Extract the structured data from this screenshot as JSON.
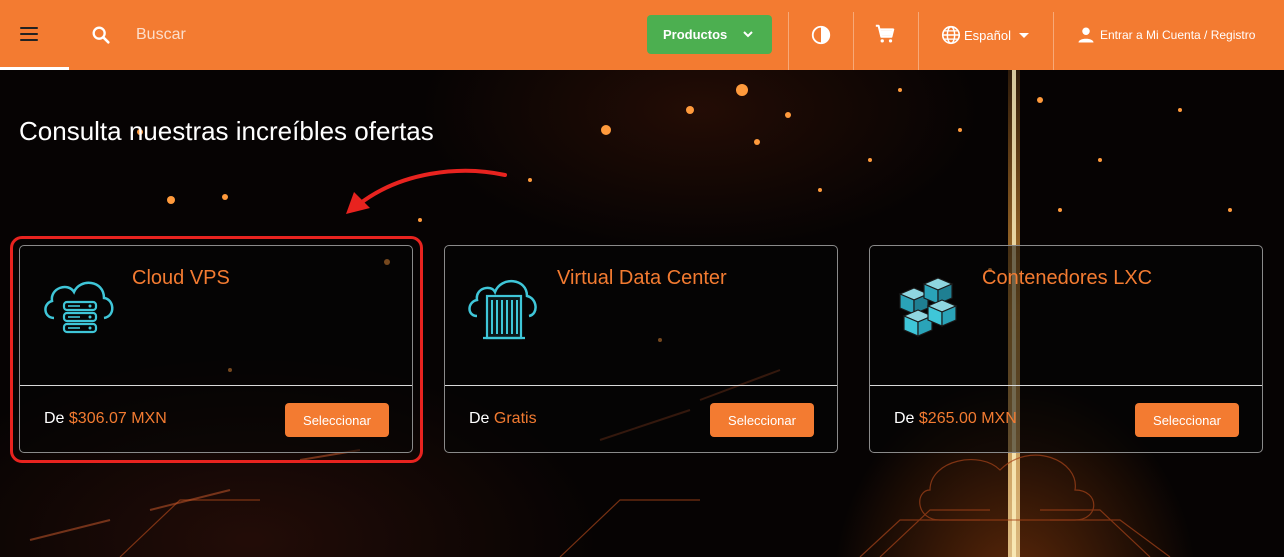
{
  "header": {
    "search_placeholder": "Buscar",
    "products_label": "Productos",
    "language_label": "Español",
    "account_label": "Entrar a Mi Cuenta / Registro"
  },
  "main": {
    "title": "Consulta nuestras increíbles ofertas"
  },
  "cards": [
    {
      "title": "Cloud VPS",
      "price_prefix": "De",
      "price": "$306.07 MXN",
      "button": "Seleccionar",
      "icon": "cloud-server-icon"
    },
    {
      "title": "Virtual Data Center",
      "price_prefix": "De",
      "price": "Gratis",
      "button": "Seleccionar",
      "icon": "cloud-datacenter-icon"
    },
    {
      "title": "Contenedores LXC",
      "price_prefix": "De",
      "price": "$265.00 MXN",
      "button": "Seleccionar",
      "icon": "containers-icon"
    }
  ],
  "colors": {
    "brand": "#f37b31",
    "products_button": "#4caf50",
    "highlight": "#e8231f",
    "icon_accent": "#3fc6d8"
  }
}
